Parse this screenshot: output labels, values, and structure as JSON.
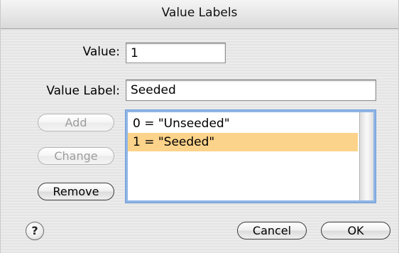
{
  "window": {
    "title": "Value Labels"
  },
  "form": {
    "value_label": "Value:",
    "value_input": "1",
    "value_label_label": "Value Label:",
    "value_label_input": "Seeded"
  },
  "buttons": {
    "add": "Add",
    "change": "Change",
    "remove": "Remove",
    "cancel": "Cancel",
    "ok": "OK",
    "help": "?"
  },
  "list": {
    "items": [
      {
        "text": "0 = \"Unseeded\"",
        "selected": false
      },
      {
        "text": "1 = \"Seeded\"",
        "selected": true
      }
    ]
  },
  "colors": {
    "selection_highlight": "#fcd38a",
    "focus_ring": "#8fb5e6"
  }
}
